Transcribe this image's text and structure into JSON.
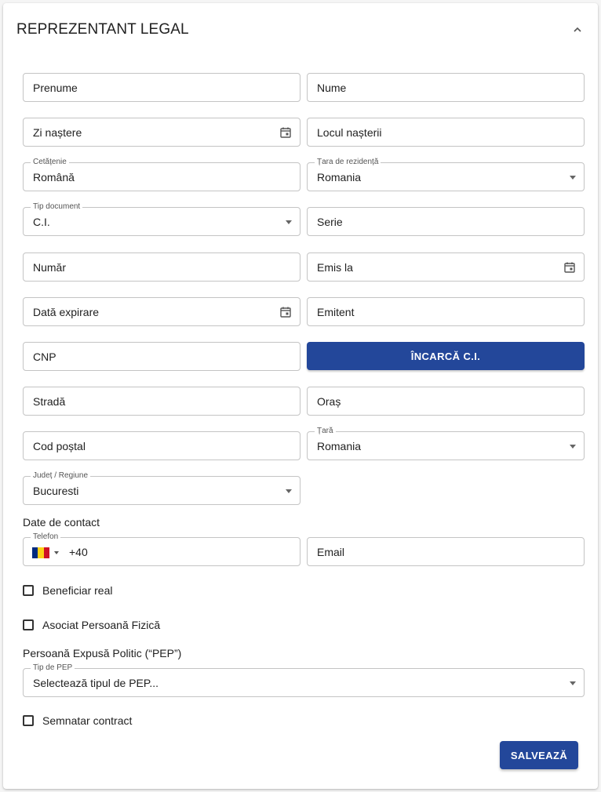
{
  "section": {
    "title": "REPREZENTANT LEGAL",
    "collapse_icon": "chevron-up-icon"
  },
  "fields": {
    "prenume": {
      "placeholder": "Prenume"
    },
    "nume": {
      "placeholder": "Nume"
    },
    "zi_nastere": {
      "placeholder": "Zi naștere",
      "icon": "calendar-icon"
    },
    "locul_nasterii": {
      "placeholder": "Locul nașterii"
    },
    "cetatenie": {
      "label": "Cetățenie",
      "value": "Română"
    },
    "tara_rezidenta": {
      "label": "Țara de rezidență",
      "value": "Romania"
    },
    "tip_document": {
      "label": "Tip document",
      "value": "C.I."
    },
    "serie": {
      "placeholder": "Serie"
    },
    "numar": {
      "placeholder": "Număr"
    },
    "emis_la": {
      "placeholder": "Emis la",
      "icon": "calendar-icon"
    },
    "data_expirare": {
      "placeholder": "Dată expirare",
      "icon": "calendar-icon"
    },
    "emitent": {
      "placeholder": "Emitent"
    },
    "cnp": {
      "placeholder": "CNP"
    },
    "strada": {
      "placeholder": "Stradă"
    },
    "oras": {
      "placeholder": "Oraș"
    },
    "cod_postal": {
      "placeholder": "Cod poștal"
    },
    "tara": {
      "label": "Țară",
      "value": "Romania"
    },
    "judet": {
      "label": "Județ / Regiune",
      "value": "Bucuresti"
    },
    "telefon": {
      "label": "Telefon",
      "prefix": "+40",
      "flag_colors": [
        "#002b7f",
        "#fcd116",
        "#ce1126"
      ]
    },
    "email": {
      "placeholder": "Email"
    },
    "tip_pep": {
      "label": "Tip de PEP",
      "value": "Selectează tipul de PEP..."
    }
  },
  "buttons": {
    "upload_ci": "ÎNCARCĂ C.I.",
    "save": "SALVEAZĂ"
  },
  "labels": {
    "contact": "Date de contact",
    "pep": "Persoană Expusă Politic (“PEP”)"
  },
  "checkboxes": {
    "beneficiar_real": {
      "label": "Beneficiar real",
      "checked": false
    },
    "asociat_pf": {
      "label": "Asociat Persoană Fizică",
      "checked": false
    },
    "semnatar_contract": {
      "label": "Semnatar contract",
      "checked": false
    }
  },
  "colors": {
    "primary": "#23479a",
    "border": "#c4c4c4"
  }
}
